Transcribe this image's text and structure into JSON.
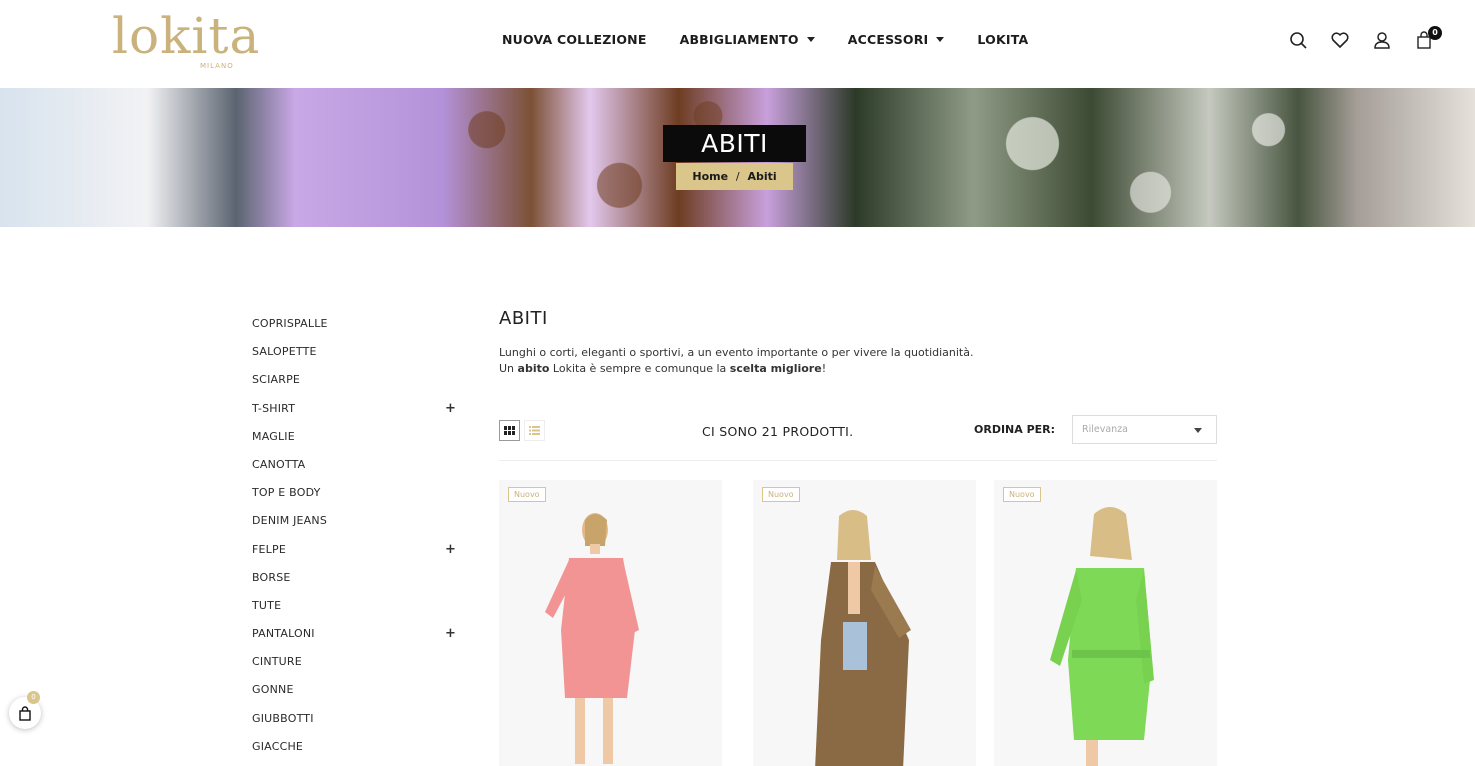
{
  "brand": {
    "logo_word": "lokita",
    "logo_sub": "MILANO",
    "accent": "#dac58b"
  },
  "nav": {
    "items": [
      {
        "label": "NUOVA COLLEZIONE",
        "dropdown": false
      },
      {
        "label": "ABBIGLIAMENTO",
        "dropdown": true
      },
      {
        "label": "ACCESSORI",
        "dropdown": true
      },
      {
        "label": "LOKITA",
        "dropdown": false
      }
    ]
  },
  "header_icons": {
    "search": "search-icon",
    "wishlist": "heart-icon",
    "account": "user-icon",
    "cart": "cart-icon",
    "cart_count": "0"
  },
  "hero": {
    "title": "ABITI",
    "breadcrumb_home": "Home",
    "breadcrumb_sep": "/",
    "breadcrumb_current": "Abiti"
  },
  "sidebar": {
    "categories": [
      {
        "label": "COPRISPALLE",
        "expandable": false
      },
      {
        "label": "SALOPETTE",
        "expandable": false
      },
      {
        "label": "SCIARPE",
        "expandable": false
      },
      {
        "label": "T-SHIRT",
        "expandable": true
      },
      {
        "label": "MAGLIE",
        "expandable": false
      },
      {
        "label": "CANOTTA",
        "expandable": false
      },
      {
        "label": "TOP E BODY",
        "expandable": false
      },
      {
        "label": "DENIM JEANS",
        "expandable": false
      },
      {
        "label": "FELPE",
        "expandable": true
      },
      {
        "label": "BORSE",
        "expandable": false
      },
      {
        "label": "TUTE",
        "expandable": false
      },
      {
        "label": "PANTALONI",
        "expandable": true
      },
      {
        "label": "CINTURE",
        "expandable": false
      },
      {
        "label": "GONNE",
        "expandable": false
      },
      {
        "label": "GIUBBOTTI",
        "expandable": false
      },
      {
        "label": "GIACCHE",
        "expandable": false
      }
    ],
    "expand_symbol": "+"
  },
  "main": {
    "title": "ABITI",
    "desc_line1": "Lunghi o corti, eleganti o sportivi, a un evento importante o per vivere la quotidianità.",
    "desc_line2_a": "Un ",
    "desc_line2_b": "abito",
    "desc_line2_c": " Lokita è sempre e comunque la ",
    "desc_line2_d": "scelta migliore",
    "desc_line2_e": "!",
    "product_count": "CI SONO 21 PRODOTTI.",
    "sort_label": "ORDINA PER:",
    "sort_value": "Rilevanza"
  },
  "products": [
    {
      "badge": "Nuovo",
      "dress_color": "#f08a8a"
    },
    {
      "badge": "Nuovo",
      "dress_color": "#8a6a44"
    },
    {
      "badge": "Nuovo",
      "dress_color": "#7ed957"
    }
  ],
  "floating_cart": {
    "count": "0"
  }
}
